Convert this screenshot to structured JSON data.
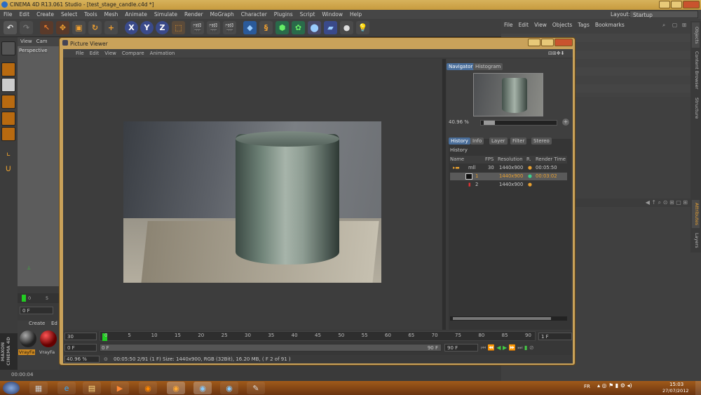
{
  "app": {
    "title": "CINEMA 4D R13.061 Studio - [test_stage_candle.c4d *]",
    "menus": [
      "File",
      "Edit",
      "Create",
      "Select",
      "Tools",
      "Mesh",
      "Animate",
      "Simulate",
      "Render",
      "MoGraph",
      "Character",
      "Plugins",
      "Script",
      "Window",
      "Help"
    ],
    "layout_label": "Layout:",
    "layout_value": "Startup"
  },
  "object_manager": {
    "menus": [
      "File",
      "Edit",
      "View",
      "Objects",
      "Tags",
      "Bookmarks"
    ]
  },
  "side_tabs": {
    "top": [
      "Objects",
      "Content Browser",
      "Structure"
    ],
    "bottom": [
      "Attributes",
      "Layers"
    ]
  },
  "viewport": {
    "menus": [
      "View",
      "Cam"
    ],
    "label": "Perspective",
    "frame_field": "0 F",
    "ruler_start": "0",
    "ruler_mark": "5"
  },
  "material_bar": {
    "menus": [
      "Create",
      "Ed"
    ],
    "materials": [
      "VrayFa",
      "VrayFa"
    ]
  },
  "status": {
    "time": "00:00:04"
  },
  "picture_viewer": {
    "title": "Picture Viewer",
    "menus": [
      "File",
      "Edit",
      "View",
      "Compare",
      "Animation"
    ],
    "nav_tabs": [
      "Navigator",
      "Histogram"
    ],
    "zoom": "40.96 %",
    "info_tabs": [
      "History",
      "Info",
      "Layer",
      "Filter",
      "Stereo"
    ],
    "history_title": "History",
    "columns": [
      "Name",
      "FPS",
      "Resolution",
      "R.",
      "Render Time"
    ],
    "rows": [
      {
        "name": "mll",
        "fps": "30",
        "res": "1440x900",
        "time": "00:05:50"
      },
      {
        "name": "1",
        "fps": "",
        "res": "1440x900",
        "time": "00:03:02"
      },
      {
        "name": "2",
        "fps": "",
        "res": "1440x900",
        "time": ""
      }
    ],
    "timeline": {
      "fps": "30",
      "ticks": [
        "0",
        "5",
        "10",
        "15",
        "20",
        "25",
        "30",
        "35",
        "40",
        "45",
        "50",
        "55",
        "60",
        "65",
        "70",
        "75",
        "80",
        "85",
        "90"
      ],
      "end_frame": "1 F",
      "start_field": "0 F",
      "slider_left": "0 F",
      "slider_right": "90 F",
      "end_field": "90 F"
    },
    "bottom_zoom": "40.96 %",
    "status_line": "00:05:50 2/91 (1 F)  Size: 1440x900, RGB (32Bit), 16.20 MB,  ( F 2 of 91 )"
  },
  "attr_toolbar_hint": "",
  "taskbar": {
    "lang": "FR",
    "clock_time": "15:03",
    "clock_date": "27/07/2012"
  },
  "maxon_label": "MAXON CINEMA 4D"
}
